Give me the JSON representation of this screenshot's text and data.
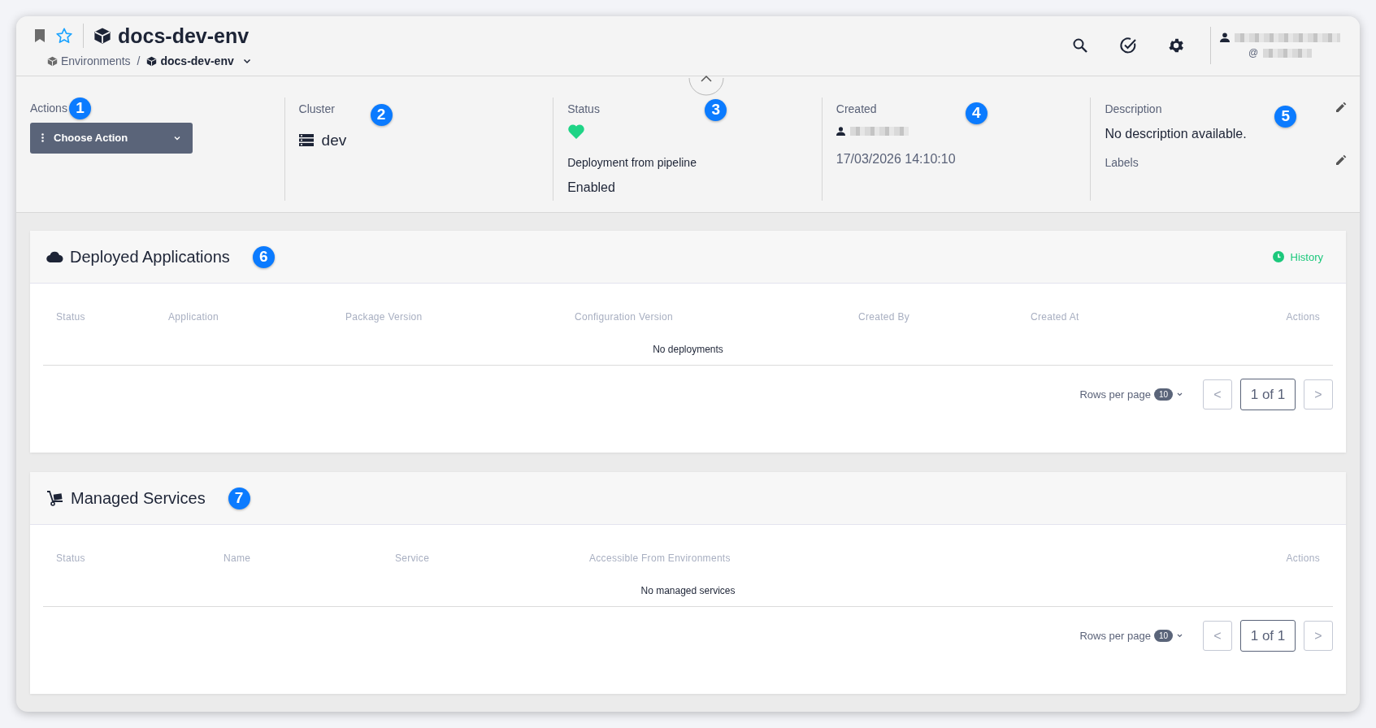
{
  "header": {
    "title": "docs-dev-env",
    "breadcrumbs": [
      {
        "label": "Environments",
        "current": false
      },
      {
        "label": "docs-dev-env",
        "current": true
      }
    ],
    "breadcrumb_separator": "/",
    "user": {
      "handle_prefix": "@"
    }
  },
  "info": {
    "actions": {
      "label": "Actions",
      "callout": "1",
      "button": "Choose Action"
    },
    "cluster": {
      "label": "Cluster",
      "value": "dev",
      "callout": "2"
    },
    "status": {
      "label": "Status",
      "callout": "3",
      "caption": "Deployment from pipeline",
      "value": "Enabled"
    },
    "created": {
      "label": "Created",
      "callout": "4",
      "timestamp": "17/03/2026 14:10:10"
    },
    "description": {
      "label": "Description",
      "text": "No description available.",
      "callout": "5",
      "labels_label": "Labels"
    }
  },
  "sections": [
    {
      "kind": "deployments",
      "title": "Deployed Applications",
      "callout": "6",
      "link": "History",
      "columns": [
        "Status",
        "Application",
        "Package Version",
        "Configuration Version",
        "Created By",
        "Created At",
        "Actions"
      ],
      "empty": "No deployments",
      "pagination": {
        "rows_label": "Rows per page",
        "rows_value": "10",
        "page": "1 of 1",
        "prev": "<",
        "next": ">"
      }
    },
    {
      "kind": "services",
      "title": "Managed Services",
      "callout": "7",
      "columns": [
        "Status",
        "Name",
        "Service",
        "Accessible From Environments",
        "Actions"
      ],
      "empty": "No managed services",
      "pagination": {
        "rows_label": "Rows per page",
        "rows_value": "10",
        "page": "1 of 1",
        "prev": "<",
        "next": ">"
      }
    }
  ]
}
